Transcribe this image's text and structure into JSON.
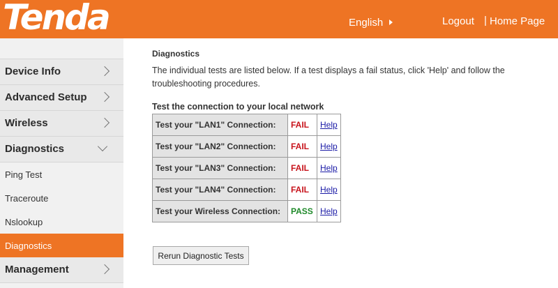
{
  "header": {
    "logo_text": "Tenda",
    "language": "English",
    "logout": "Logout",
    "separator": "|",
    "home_page": "Home Page"
  },
  "sidebar": {
    "items": [
      {
        "label": "Device Info",
        "type": "main",
        "expanded": false
      },
      {
        "label": "Advanced Setup",
        "type": "main",
        "expanded": false
      },
      {
        "label": "Wireless",
        "type": "main",
        "expanded": false
      },
      {
        "label": "Diagnostics",
        "type": "main",
        "expanded": true
      },
      {
        "label": "Ping Test",
        "type": "sub"
      },
      {
        "label": "Traceroute",
        "type": "sub"
      },
      {
        "label": "Nslookup",
        "type": "sub"
      },
      {
        "label": "Diagnostics",
        "type": "sub",
        "active": true
      },
      {
        "label": "Management",
        "type": "main",
        "expanded": false
      }
    ]
  },
  "main": {
    "title": "Diagnostics",
    "description": "The individual tests are listed below. If a test displays a fail status, click 'Help' and follow the troubleshooting procedures.",
    "section_title": "Test the connection to your local network",
    "tests": [
      {
        "name": "Test your \"LAN1\" Connection:",
        "status": "FAIL",
        "help": "Help"
      },
      {
        "name": "Test your \"LAN2\" Connection:",
        "status": "FAIL",
        "help": "Help"
      },
      {
        "name": "Test your \"LAN3\" Connection:",
        "status": "FAIL",
        "help": "Help"
      },
      {
        "name": "Test your \"LAN4\" Connection:",
        "status": "FAIL",
        "help": "Help"
      },
      {
        "name": "Test your Wireless Connection:",
        "status": "PASS",
        "help": "Help"
      }
    ],
    "rerun_button": "Rerun Diagnostic Tests"
  },
  "colors": {
    "brand_orange": "#ee7424",
    "fail_red": "#c8141c",
    "pass_green": "#1f8a2a",
    "link_blue": "#1a1aa6"
  }
}
